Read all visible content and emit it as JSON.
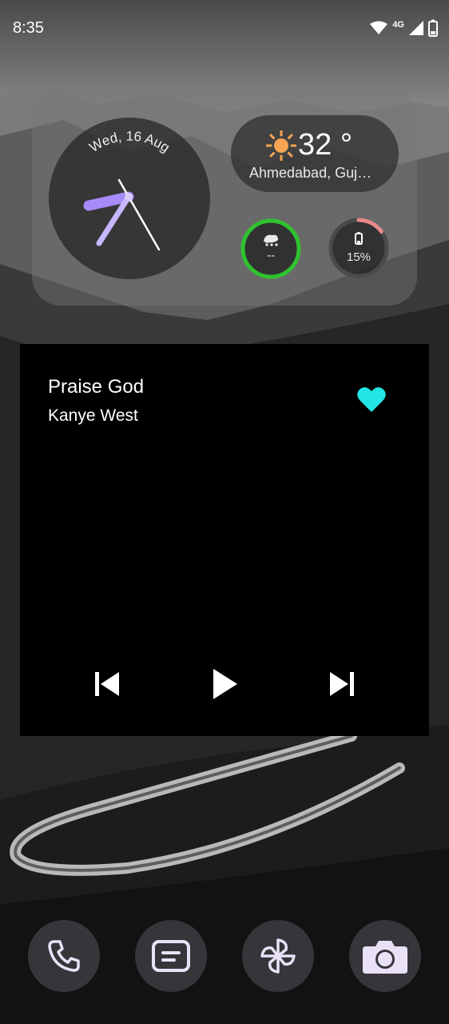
{
  "status_bar": {
    "time": "8:35",
    "network": "4G",
    "icons": [
      "wifi-icon",
      "signal-icon",
      "battery-icon"
    ]
  },
  "clock_widget": {
    "date": "Wed, 16 Aug",
    "hands_color": "#a78bfa"
  },
  "weather_widget": {
    "temperature": "32 °",
    "location": "Ahmedabad, Guj…",
    "icon": "sun-icon",
    "icon_color": "#f5a454"
  },
  "rings": [
    {
      "name": "weather-condition-ring",
      "label": "--",
      "icon": "cloud-icon",
      "color": "#2fc22f",
      "level": 1.0
    },
    {
      "name": "battery-ring",
      "label": "15%",
      "icon": "battery-icon",
      "color": "#e8898a",
      "level": 0.15
    }
  ],
  "music_widget": {
    "title": "Praise God",
    "artist": "Kanye West",
    "favorite_color": "#22e5e5",
    "controls": [
      "previous-track-icon",
      "play-icon",
      "next-track-icon"
    ]
  },
  "dock": [
    {
      "name": "phone-app",
      "icon": "phone-icon"
    },
    {
      "name": "messages-app",
      "icon": "message-icon"
    },
    {
      "name": "gallery-app",
      "icon": "pinwheel-icon"
    },
    {
      "name": "camera-app",
      "icon": "camera-icon"
    }
  ],
  "colors": {
    "dock_icon": "#e9e2f7",
    "dock_bg": "#36353a"
  }
}
